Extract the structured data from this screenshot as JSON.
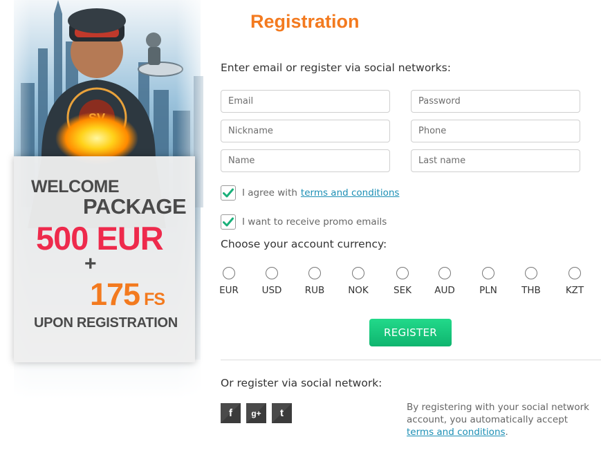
{
  "promo": {
    "line1": "WELCOME",
    "line2": "PACKAGE",
    "amount": "500 EUR",
    "plus": "+",
    "spins_number": "175",
    "spins_unit": "FS",
    "line_last": "UPON REGISTRATION",
    "emblem_text": "SV"
  },
  "form": {
    "title": "Registration",
    "intro": "Enter email or register via social networks:",
    "fields": {
      "email": "Email",
      "password": "Password",
      "nickname": "Nickname",
      "phone": "Phone",
      "name": "Name",
      "last_name": "Last name"
    },
    "agree_prefix": "I agree with",
    "agree_link": "terms and conditions",
    "agree_checked": true,
    "promo_label": "I want to receive promo emails",
    "promo_checked": true,
    "currency_title": "Choose your account currency:",
    "currencies": [
      "EUR",
      "USD",
      "RUB",
      "NOK",
      "SEK",
      "AUD",
      "PLN",
      "THB",
      "KZT"
    ],
    "register_label": "REGISTER"
  },
  "social": {
    "title": "Or register via social network:",
    "buttons": [
      {
        "icon": "facebook-icon",
        "glyph": "f"
      },
      {
        "icon": "google-plus-icon",
        "glyph": "g+"
      },
      {
        "icon": "twitter-icon",
        "glyph": "t"
      }
    ],
    "note_text": "By registering with your social network account, you automatically accept",
    "note_link": "terms and conditions",
    "note_end": "."
  },
  "colors": {
    "accent_orange": "#f37a1f",
    "amount_red": "#ee2a4c",
    "button_green": "#1bcb7e",
    "link_blue": "#1c8fb5",
    "check_green": "#1ab07a"
  }
}
